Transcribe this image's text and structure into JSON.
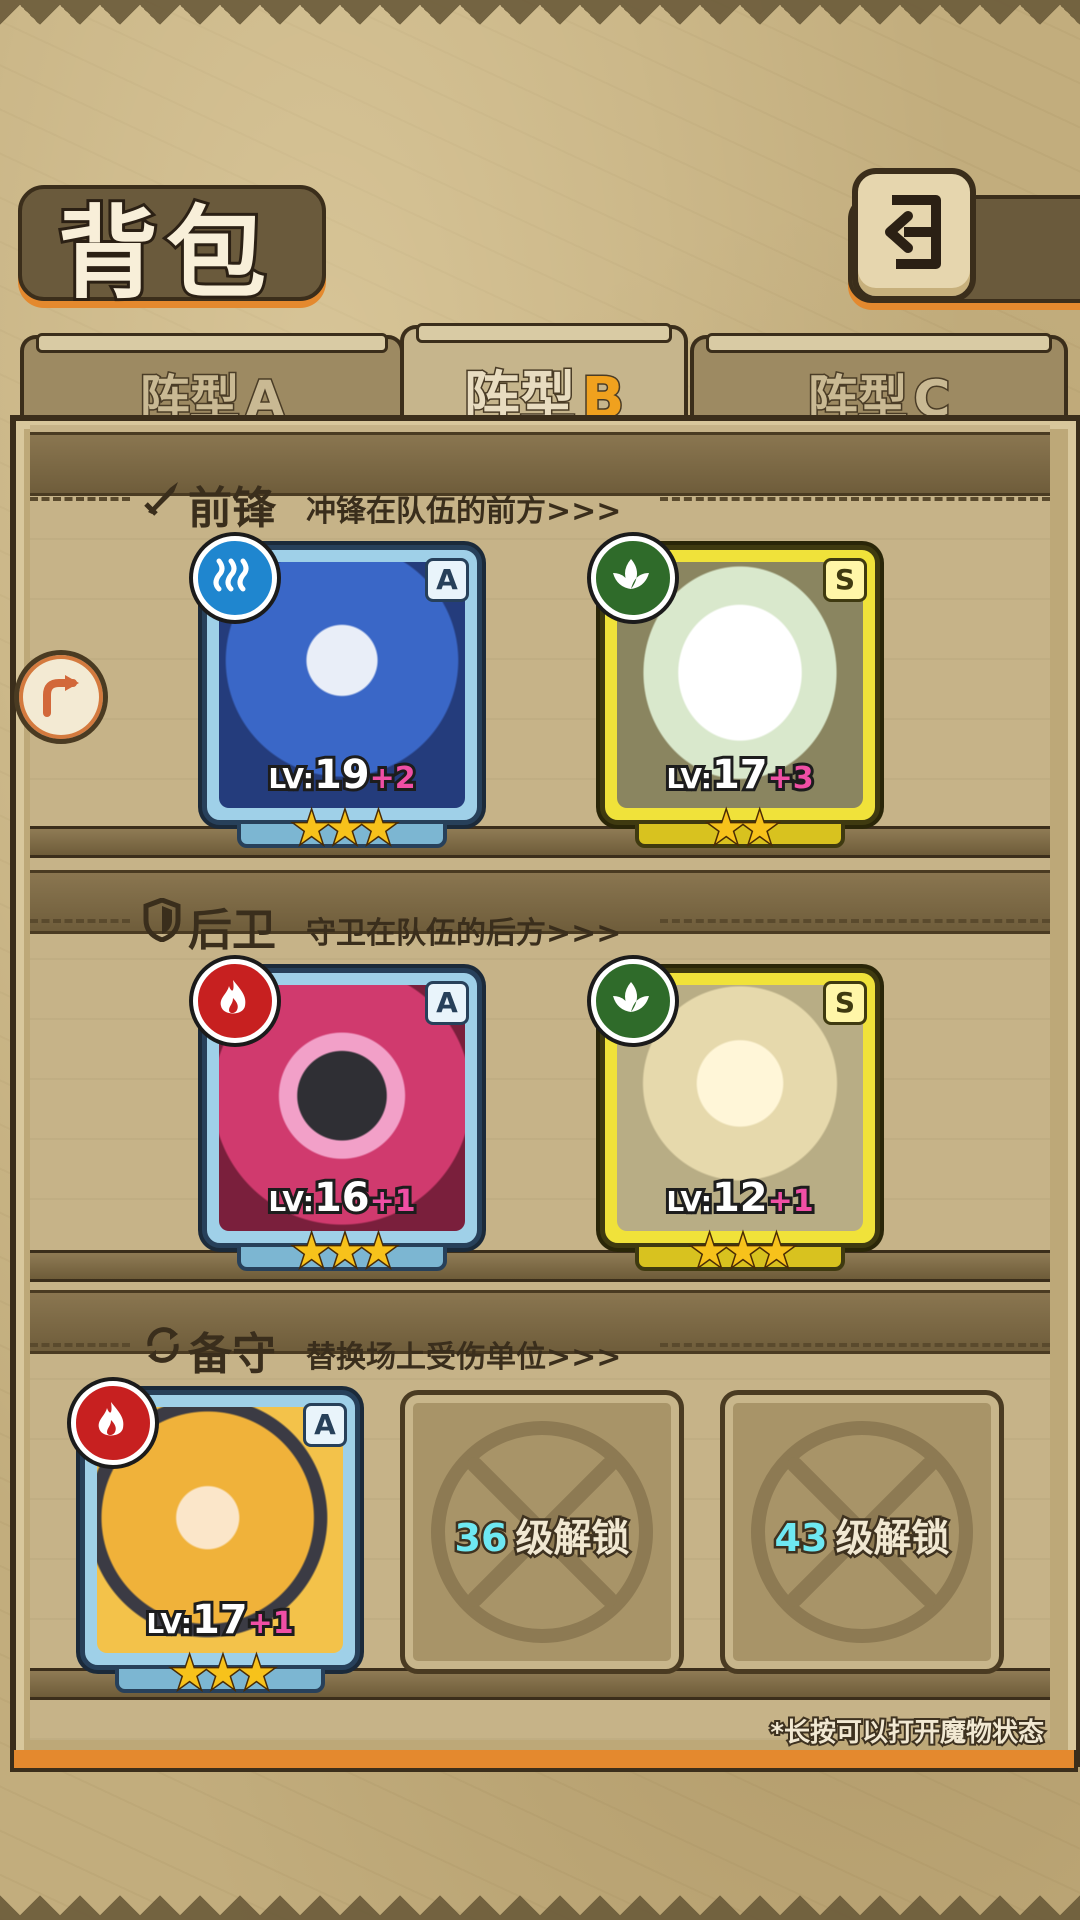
{
  "header": {
    "title": "背包",
    "back_icon": "return-arrow-icon"
  },
  "tabs": [
    {
      "label": "阵型",
      "letter": "A",
      "active": false
    },
    {
      "label": "阵型",
      "letter": "B",
      "active": true
    },
    {
      "label": "阵型",
      "letter": "C",
      "active": false
    }
  ],
  "sections": {
    "front": {
      "title": "前锋",
      "subtitle": "冲锋在队伍的前方>>>",
      "icon": "sword-icon"
    },
    "back": {
      "title": "后卫",
      "subtitle": "守卫在队伍的后方>>>",
      "icon": "shield-icon"
    },
    "reserve": {
      "title": "备守",
      "subtitle": "替换场上受伤单位>>>",
      "icon": "swap-icon"
    }
  },
  "units": [
    {
      "slot": "front-1",
      "element": "water",
      "element_color": "#1f86cf",
      "rank": "A",
      "lv_label": "LV:",
      "level": "19",
      "bonus": "+2",
      "stars": 3,
      "frame": "blue",
      "art_color": "#3a67c7"
    },
    {
      "slot": "front-2",
      "element": "leaf",
      "element_color": "#2f6b2a",
      "rank": "S",
      "lv_label": "LV:",
      "level": "17",
      "bonus": "+3",
      "stars": 2,
      "frame": "gold",
      "art_color": "#8a8560"
    },
    {
      "slot": "back-1",
      "element": "fire",
      "element_color": "#c72020",
      "rank": "A",
      "lv_label": "LV:",
      "level": "16",
      "bonus": "+1",
      "stars": 3,
      "frame": "blue",
      "art_color": "#d03a6e"
    },
    {
      "slot": "back-2",
      "element": "leaf",
      "element_color": "#2f6b2a",
      "rank": "S",
      "lv_label": "LV:",
      "level": "12",
      "bonus": "+1",
      "stars": 3,
      "frame": "gold",
      "art_color": "#b8ad85"
    },
    {
      "slot": "reserve-1",
      "element": "fire",
      "element_color": "#c72020",
      "rank": "A",
      "lv_label": "LV:",
      "level": "17",
      "bonus": "+1",
      "stars": 3,
      "frame": "blue",
      "art_color": "#f0b23a"
    }
  ],
  "locked_slots": [
    {
      "level": "36",
      "text": "级解锁"
    },
    {
      "level": "43",
      "text": "级解锁"
    }
  ],
  "hint": "*长按可以打开魔物状态",
  "side_button_icon": "direction-arrow-icon"
}
